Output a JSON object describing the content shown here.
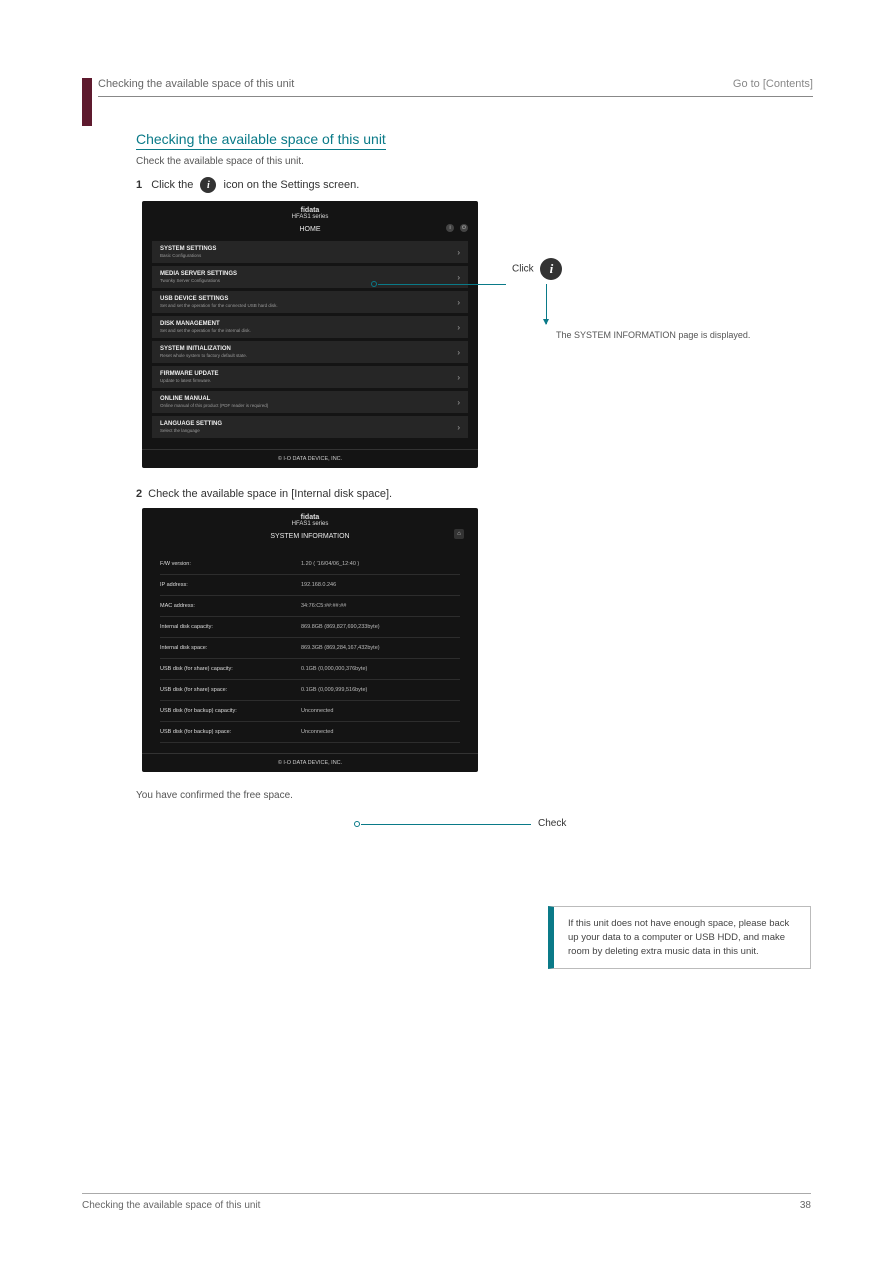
{
  "header": {
    "section_path": "Checking the available space of this unit",
    "go_to": "Go to [Contents]"
  },
  "title": "Checking the available space of this unit",
  "subtitle": "Check the available space of this unit.",
  "step1": {
    "num": "1",
    "text_a": "Click the",
    "text_b": "icon on the Settings screen."
  },
  "screenshot1": {
    "brand": "fidata",
    "series": "HFAS1 series",
    "home": "HOME",
    "menu": [
      {
        "title": "SYSTEM SETTINGS",
        "sub": "Basic Configurations"
      },
      {
        "title": "MEDIA SERVER SETTINGS",
        "sub": "Twonky Server Configurations"
      },
      {
        "title": "USB DEVICE SETTINGS",
        "sub": "Set and set the operation for the connected USB hard disk."
      },
      {
        "title": "DISK MANAGEMENT",
        "sub": "Set and set the operation for the internal disk."
      },
      {
        "title": "SYSTEM INITIALIZATION",
        "sub": "Reset whole system to factory default state."
      },
      {
        "title": "FIRMWARE UPDATE",
        "sub": "Update to latest firmware."
      },
      {
        "title": "ONLINE MANUAL",
        "sub": "Online manual of this product (PDF reader is required)"
      },
      {
        "title": "LANGUAGE SETTING",
        "sub": "Select the language"
      }
    ],
    "footer": "© I-O DATA DEVICE, INC."
  },
  "annot1": "Click",
  "arrow_label": "The SYSTEM INFORMATION page is displayed.",
  "step2": {
    "num": "2",
    "text": "Check the available space in [Internal disk space]."
  },
  "screenshot2": {
    "brand": "fidata",
    "series": "HFAS1 series",
    "title": "SYSTEM INFORMATION",
    "rows": [
      {
        "k": "F/W version:",
        "v": "1.20 ( '16/04/06_12:40 )"
      },
      {
        "k": "IP address:",
        "v": "192.168.0.246"
      },
      {
        "k": "MAC address:",
        "v": "34:76:C5:##:##:##"
      },
      {
        "k": "Internal disk capacity:",
        "v": "869.8GB (869,827,690,233byte)"
      },
      {
        "k": "Internal disk space:",
        "v": "869.3GB (869,284,167,432byte)"
      },
      {
        "k": "USB disk (for share) capacity:",
        "v": "0.1GB (0,000,000,376byte)"
      },
      {
        "k": "USB disk (for share) space:",
        "v": "0.1GB (0,009,999,516byte)"
      },
      {
        "k": "USB disk (for backup) capacity:",
        "v": "Unconnected"
      },
      {
        "k": "USB disk (for backup) space:",
        "v": "Unconnected"
      }
    ],
    "footer": "© I-O DATA DEVICE, INC."
  },
  "annot2": "Check",
  "confirmed": "You have confirmed the free space.",
  "note": "If this unit does not have enough space, please back up your data to a computer or USB HDD, and make room by deleting extra music data in this unit.",
  "footer": {
    "left": "Checking the available space of this unit",
    "right": "38"
  }
}
